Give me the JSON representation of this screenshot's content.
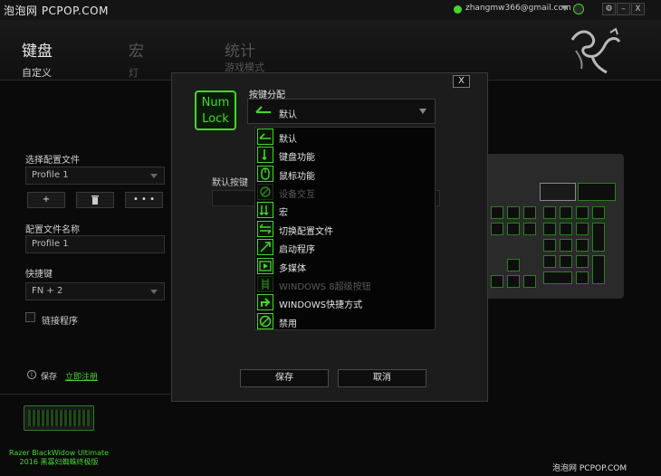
{
  "watermark": "泡泡网 PCPOP.COM",
  "account": {
    "email": "zhangmw366@gmail.com"
  },
  "window_buttons": [
    "⚙",
    "–",
    "X"
  ],
  "nav": {
    "tabs": [
      {
        "label": "键盘",
        "active": true
      },
      {
        "label": "宏",
        "active": false
      },
      {
        "label": "统计",
        "active": false
      }
    ],
    "subtabs": [
      {
        "label": "自定义",
        "active": true
      },
      {
        "label": "灯",
        "active": false
      },
      {
        "label": "游戏模式",
        "active": false
      }
    ]
  },
  "profile": {
    "select_label": "选择配置文件",
    "selected": "Profile 1",
    "add_button": "+",
    "delete_icon": "trash-icon",
    "more_button": "• • •",
    "name_label": "配置文件名称",
    "name_value": "Profile 1",
    "hotkey_label": "快捷键",
    "hotkey_value": "FN + 2",
    "link_label": "链接程序"
  },
  "sync": {
    "label": "保存",
    "link": "立即注册"
  },
  "device": {
    "name_line1": "Razer BlackWidow Ultimate",
    "name_line2": "2016 黑寡妇蜘蛛终极版"
  },
  "modal": {
    "close": "X",
    "key_name_line1": "Num",
    "key_name_line2": "Lock",
    "assign_label": "按键分配",
    "assign_value": "默认",
    "default_key_label": "默认按键",
    "save_button": "保存",
    "cancel_button": "取消",
    "options": [
      {
        "label": "默认",
        "icon": "default-icon",
        "enabled": true
      },
      {
        "label": "键盘功能",
        "icon": "keyboard-function-icon",
        "enabled": true
      },
      {
        "label": "鼠标功能",
        "icon": "mouse-icon",
        "enabled": true
      },
      {
        "label": "设备交互",
        "icon": "inter-device-icon",
        "enabled": false
      },
      {
        "label": "宏",
        "icon": "macro-icon",
        "enabled": true
      },
      {
        "label": "切换配置文件",
        "icon": "switch-profile-icon",
        "enabled": true
      },
      {
        "label": "启动程序",
        "icon": "launch-program-icon",
        "enabled": true
      },
      {
        "label": "多媒体",
        "icon": "multimedia-icon",
        "enabled": true
      },
      {
        "label": "WINDOWS 8超级按钮",
        "icon": "windows8-charms-icon",
        "enabled": false
      },
      {
        "label": "WINDOWS快捷方式",
        "icon": "windows-shortcut-icon",
        "enabled": true
      },
      {
        "label": "禁用",
        "icon": "disable-icon",
        "enabled": true
      }
    ]
  },
  "footer_watermark": "泡泡网 PCPOP.COM",
  "colors": {
    "accent": "#44d62c",
    "background": "#0a0a0a"
  }
}
